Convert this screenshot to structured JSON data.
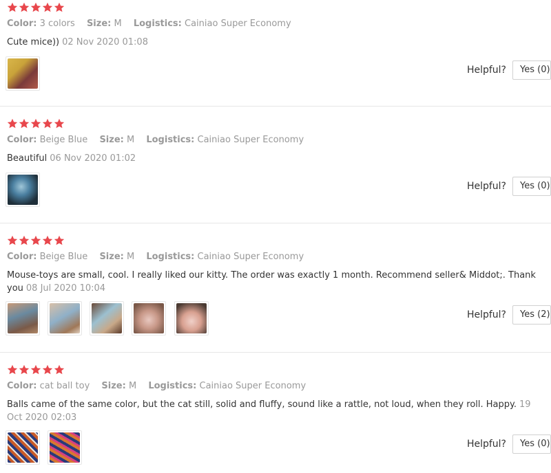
{
  "colors": {
    "star": "#e8474c",
    "meta": "#999999",
    "text": "#333333",
    "border": "#e6e6e6"
  },
  "icons": {
    "star": "star-icon"
  },
  "reviews": [
    {
      "rating": 5,
      "color_label": "Color:",
      "color_value": "3 colors",
      "size_label": "Size:",
      "size_value": "M",
      "logistics_label": "Logistics:",
      "logistics_value": "Cainiao Super Economy",
      "text": "Cute mice))",
      "date": "02 Nov 2020 01:08",
      "photo_count": 1,
      "helpful_label": "Helpful?",
      "yes_label": "Yes (0)"
    },
    {
      "rating": 5,
      "color_label": "Color:",
      "color_value": "Beige Blue",
      "size_label": "Size:",
      "size_value": "M",
      "logistics_label": "Logistics:",
      "logistics_value": "Cainiao Super Economy",
      "text": "Beautiful",
      "date": "06 Nov 2020 01:02",
      "photo_count": 1,
      "helpful_label": "Helpful?",
      "yes_label": "Yes (0)"
    },
    {
      "rating": 5,
      "color_label": "Color:",
      "color_value": "Beige Blue",
      "size_label": "Size:",
      "size_value": "M",
      "logistics_label": "Logistics:",
      "logistics_value": "Cainiao Super Economy",
      "text": "Mouse-toys are small, cool. I really liked our kitty. The order was exactly 1 month. Recommend seller& Middot;. Thank you",
      "date": "08 Jul 2020 10:04",
      "photo_count": 5,
      "helpful_label": "Helpful?",
      "yes_label": "Yes (2)"
    },
    {
      "rating": 5,
      "color_label": "Color:",
      "color_value": "cat ball toy",
      "size_label": "Size:",
      "size_value": "M",
      "logistics_label": "Logistics:",
      "logistics_value": "Cainiao Super Economy",
      "text": "Balls came of the same color, but the cat still, solid and fluffy, sound like a rattle, not loud, when they roll. Happy.",
      "date": "19 Oct 2020 02:03",
      "photo_count": 2,
      "helpful_label": "Helpful?",
      "yes_label": "Yes (0)"
    }
  ]
}
